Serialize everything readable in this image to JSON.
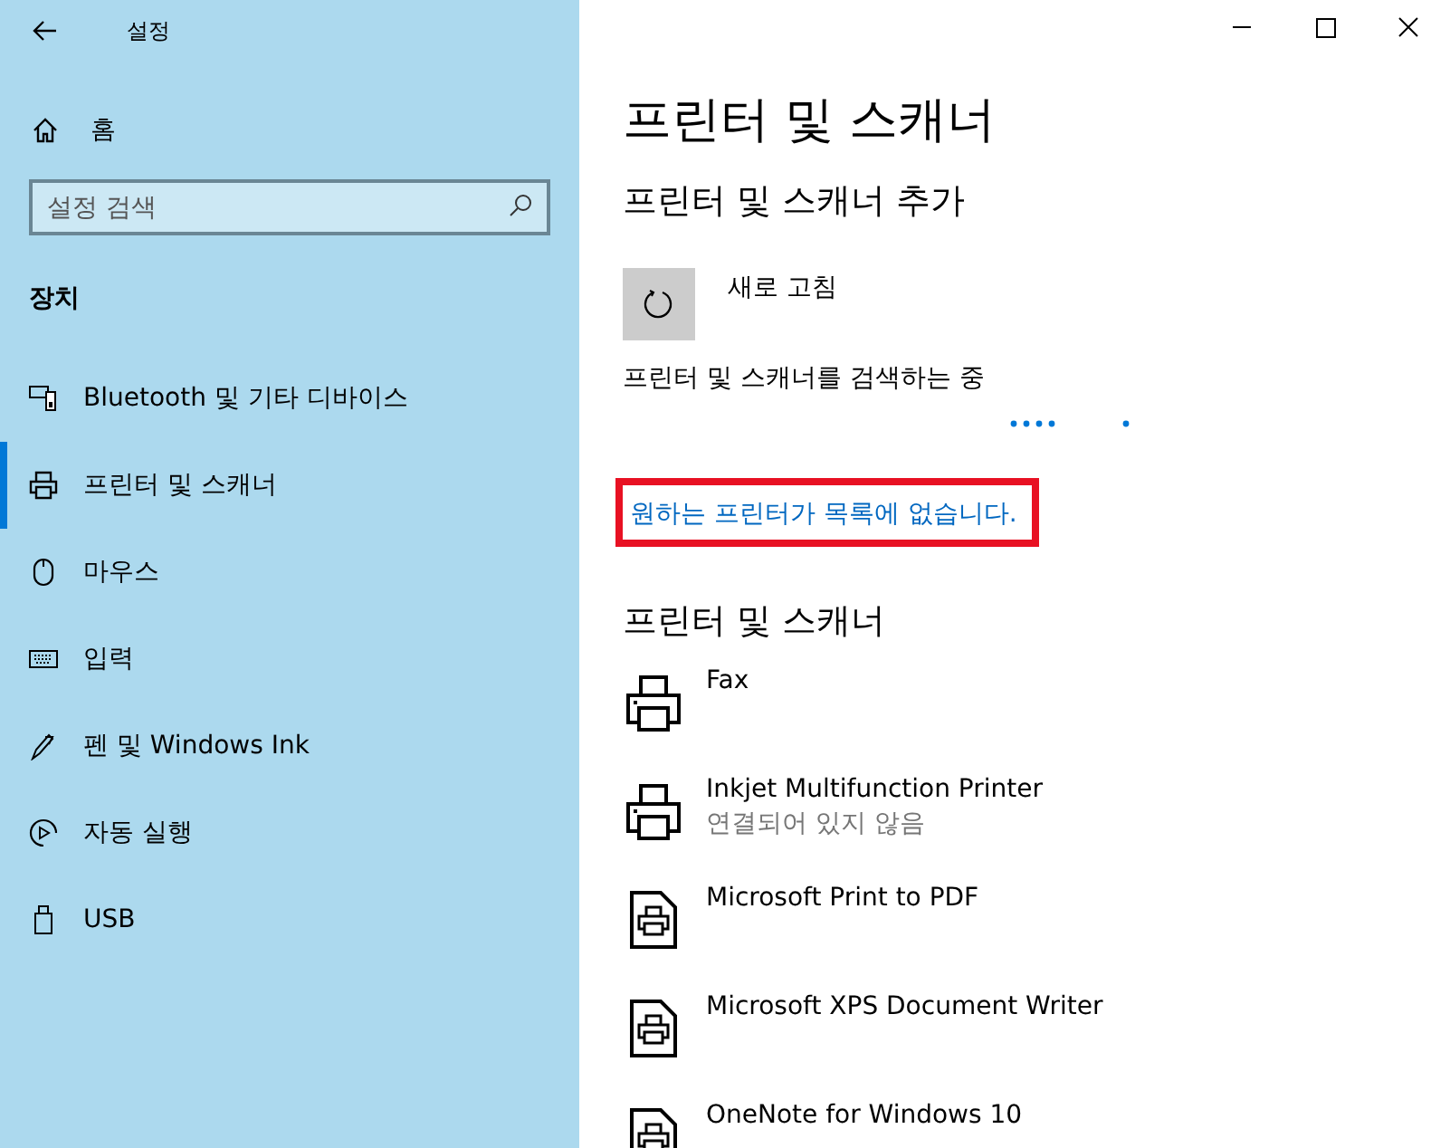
{
  "window": {
    "title": "설정"
  },
  "sidebar": {
    "home": "홈",
    "search": {
      "placeholder": "설정 검색"
    },
    "section": "장치",
    "items": [
      {
        "kind": "bluetooth",
        "label": "Bluetooth 및 기타 디바이스",
        "selected": false
      },
      {
        "kind": "printer",
        "label": "프린터 및 스캐너",
        "selected": true
      },
      {
        "kind": "mouse",
        "label": "마우스",
        "selected": false
      },
      {
        "kind": "keyboard",
        "label": "입력",
        "selected": false
      },
      {
        "kind": "pen",
        "label": "펜 및 Windows Ink",
        "selected": false
      },
      {
        "kind": "autoplay",
        "label": "자동 실행",
        "selected": false
      },
      {
        "kind": "usb",
        "label": "USB",
        "selected": false
      }
    ]
  },
  "main": {
    "title": "프린터 및 스캐너",
    "add_heading": "프린터 및 스캐너 추가",
    "refresh": "새로 고침",
    "searching": "프린터 및 스캐너를 검색하는 중",
    "link": {
      "text": "원하는 프린터가 목록에 없습니다.",
      "highlighted": true
    },
    "list_heading": "프린터 및 스캐너",
    "devices": [
      {
        "kind": "printer",
        "name": "Fax"
      },
      {
        "kind": "printer",
        "name": "Inkjet Multifunction Printer",
        "status": "연결되어 있지 않음"
      },
      {
        "kind": "document",
        "name": "Microsoft Print to PDF"
      },
      {
        "kind": "document",
        "name": "Microsoft XPS Document Writer"
      },
      {
        "kind": "document",
        "name": "OneNote for Windows 10"
      }
    ]
  }
}
